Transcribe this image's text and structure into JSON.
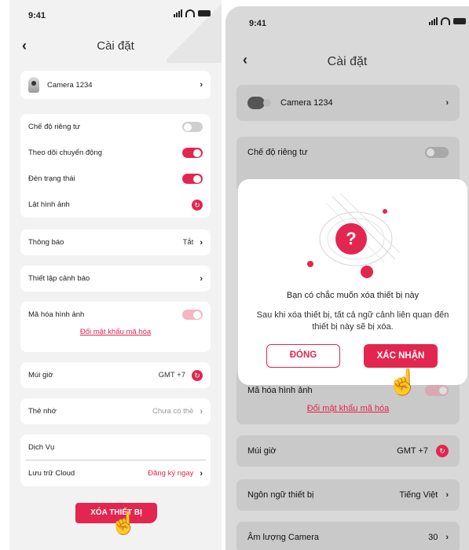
{
  "left": {
    "status": {
      "time": "9:41"
    },
    "title": "Cài đặt",
    "camera": {
      "name": "Camera 1234"
    },
    "privacy": {
      "label": "Chế độ riêng tư",
      "on": false
    },
    "motion": {
      "label": "Theo dõi chuyển động",
      "on": true
    },
    "status_light": {
      "label": "Đèn trạng thái",
      "on": true
    },
    "flip": {
      "label": "Lật hình ảnh"
    },
    "notifications": {
      "label": "Thông báo",
      "value": "Tắt"
    },
    "alert_setup": {
      "label": "Thiết lập cảnh báo"
    },
    "encryption": {
      "label": "Mã hóa hình ảnh",
      "link": "Đổi mật khẩu mã hóa",
      "on": true
    },
    "timezone": {
      "label": "Múi giờ",
      "value": "GMT +7"
    },
    "memory_card": {
      "label": "Thẻ nhớ",
      "value": "Chưa có thẻ"
    },
    "services": {
      "label": "Dịch Vụ"
    },
    "cloud": {
      "label": "Lưu trữ Cloud",
      "value": "Đăng ký ngay"
    },
    "delete_label": "XÓA THIẾT BỊ"
  },
  "right": {
    "status": {
      "time": "9:41"
    },
    "title": "Cài đặt",
    "camera": {
      "name": "Camera 1234"
    },
    "privacy": {
      "label": "Chế độ riêng tư"
    },
    "encryption": {
      "label": "Mã hóa hình ảnh",
      "link": "Đổi mật khẩu mã hóa"
    },
    "timezone": {
      "label": "Múi giờ",
      "value": "GMT +7"
    },
    "language": {
      "label": "Ngôn ngữ thiết bị",
      "value": "Tiếng Việt"
    },
    "volume": {
      "label": "Âm lượng Camera",
      "value": "30"
    },
    "modal": {
      "title": "Bạn có chắc muốn xóa thiết bị này",
      "body": "Sau khi xóa thiết bị, tất cả ngữ cảnh liên quan đến thiết bị này sẽ bị xóa.",
      "close_label": "ĐÓNG",
      "confirm_label": "XÁC NHẬN"
    }
  },
  "colors": {
    "accent": "#e3264f"
  },
  "icons": [
    "back-icon",
    "chevron-right-icon",
    "refresh-icon",
    "question-icon",
    "hand-pointer-icon"
  ]
}
